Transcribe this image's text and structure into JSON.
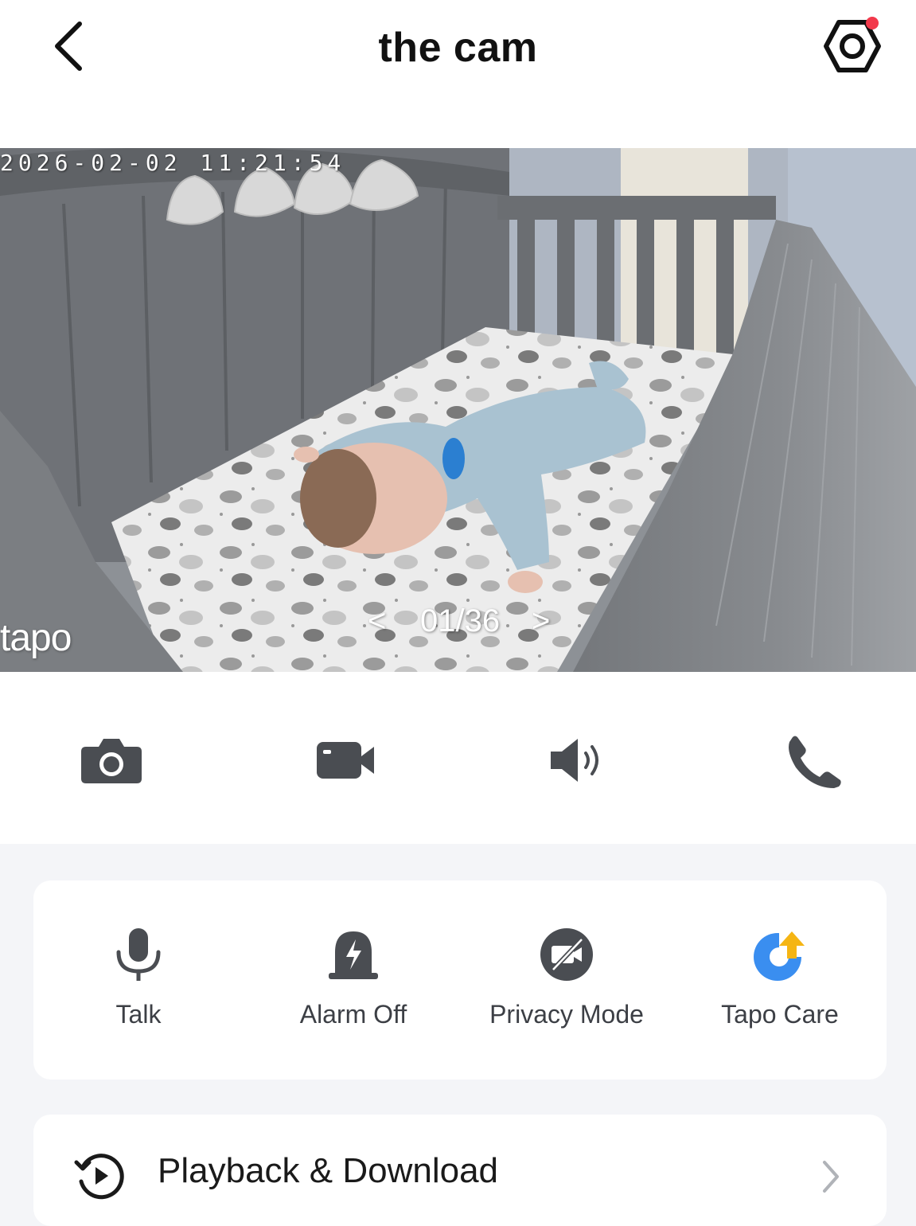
{
  "header": {
    "title": "the cam",
    "back_icon": "chevron-left-icon",
    "settings_icon": "gear-icon",
    "notification_dot_color": "#f2394b"
  },
  "video": {
    "timestamp": "2026-02-02 11:21:54",
    "watermark": "tapo",
    "pager": {
      "prev": "<",
      "counter": "01/36",
      "next": ">"
    }
  },
  "controls": [
    {
      "name": "snapshot",
      "icon": "camera-icon"
    },
    {
      "name": "record",
      "icon": "video-camera-icon"
    },
    {
      "name": "sound",
      "icon": "speaker-icon"
    },
    {
      "name": "call",
      "icon": "phone-icon"
    }
  ],
  "features": {
    "talk": {
      "label": "Talk",
      "icon": "microphone-icon"
    },
    "alarm": {
      "label": "Alarm Off",
      "icon": "alarm-icon"
    },
    "privacy": {
      "label": "Privacy Mode",
      "icon": "privacy-mode-icon"
    },
    "care": {
      "label": "Tapo Care",
      "icon": "tapo-care-icon",
      "accent_blue": "#3a8ef0",
      "accent_yellow": "#f5b514"
    }
  },
  "menu": {
    "playback": {
      "label": "Playback & Download",
      "icon": "playback-icon"
    }
  }
}
